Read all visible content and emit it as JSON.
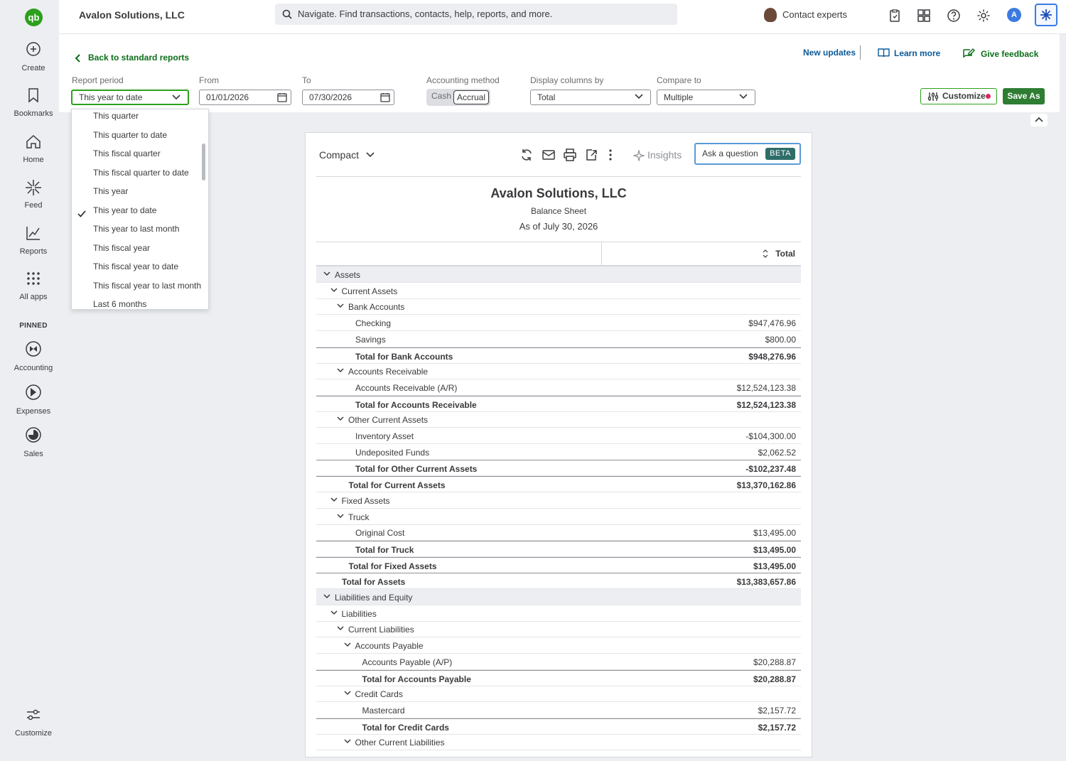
{
  "app": {
    "company_name": "Avalon Solutions, LLC",
    "search_placeholder": "Navigate. Find transactions, contacts, help, reports, and more.",
    "contact_experts": "Contact experts",
    "user_initial": "A",
    "logo_text": "qb"
  },
  "sidebar": {
    "create": "Create",
    "bookmarks": "Bookmarks",
    "home": "Home",
    "feed": "Feed",
    "reports": "Reports",
    "all_apps": "All apps",
    "pinned": "PINNED",
    "accounting": "Accounting",
    "expenses": "Expenses",
    "sales": "Sales",
    "customize": "Customize"
  },
  "header": {
    "back_link": "Back to standard reports",
    "new_updates": "New updates",
    "learn_more": "Learn more",
    "give_feedback": "Give feedback"
  },
  "filters": {
    "report_period_label": "Report period",
    "report_period_value": "This year to date",
    "from_label": "From",
    "from_value": "01/01/2026",
    "to_label": "To",
    "to_value": "07/30/2026",
    "accounting_method_label": "Accounting method",
    "cash": "Cash",
    "accrual": "Accrual",
    "display_columns_label": "Display columns by",
    "display_columns_value": "Total",
    "compare_to_label": "Compare to",
    "compare_to_value": "Multiple",
    "customize": "Customize",
    "save_as": "Save As"
  },
  "period_options": [
    "This quarter",
    "This quarter to date",
    "This fiscal quarter",
    "This fiscal quarter to date",
    "This year",
    "This year to date",
    "This year to last month",
    "This fiscal year",
    "This fiscal year to date",
    "This fiscal year to last month",
    "Last 6 months"
  ],
  "report": {
    "view": "Compact",
    "insights": "Insights",
    "ask": "Ask a question",
    "beta": "BETA",
    "company": "Avalon Solutions, LLC",
    "title": "Balance Sheet",
    "as_of": "As of July 30, 2026",
    "column": "Total",
    "rows": [
      {
        "label": "Assets",
        "value": "",
        "kind": "section",
        "level": 0
      },
      {
        "label": "Current Assets",
        "value": "",
        "kind": "group",
        "level": 1
      },
      {
        "label": "Bank Accounts",
        "value": "",
        "kind": "group",
        "level": 2
      },
      {
        "label": "Checking",
        "value": "$947,476.96",
        "kind": "item",
        "level": 3
      },
      {
        "label": "Savings",
        "value": "$800.00",
        "kind": "item",
        "level": 3
      },
      {
        "label": "Total for Bank Accounts",
        "value": "$948,276.96",
        "kind": "total",
        "level": 3
      },
      {
        "label": "Accounts Receivable",
        "value": "",
        "kind": "group",
        "level": 2
      },
      {
        "label": "Accounts Receivable (A/R)",
        "value": "$12,524,123.38",
        "kind": "item",
        "level": 3
      },
      {
        "label": "Total for Accounts Receivable",
        "value": "$12,524,123.38",
        "kind": "total",
        "level": 3
      },
      {
        "label": "Other Current Assets",
        "value": "",
        "kind": "group",
        "level": 2
      },
      {
        "label": "Inventory Asset",
        "value": "-$104,300.00",
        "kind": "item",
        "level": 3
      },
      {
        "label": "Undeposited Funds",
        "value": "$2,062.52",
        "kind": "item",
        "level": 3
      },
      {
        "label": "Total for Other Current Assets",
        "value": "-$102,237.48",
        "kind": "total",
        "level": 3
      },
      {
        "label": "Total for Current Assets",
        "value": "$13,370,162.86",
        "kind": "total",
        "level": 2
      },
      {
        "label": "Fixed Assets",
        "value": "",
        "kind": "group",
        "level": 1
      },
      {
        "label": "Truck",
        "value": "",
        "kind": "group",
        "level": 2
      },
      {
        "label": "Original Cost",
        "value": "$13,495.00",
        "kind": "item",
        "level": 3
      },
      {
        "label": "Total for Truck",
        "value": "$13,495.00",
        "kind": "total",
        "level": 3
      },
      {
        "label": "Total for Fixed Assets",
        "value": "$13,495.00",
        "kind": "total",
        "level": 2
      },
      {
        "label": "Total for Assets",
        "value": "$13,383,657.86",
        "kind": "total",
        "level": 1
      },
      {
        "label": "Liabilities and Equity",
        "value": "",
        "kind": "section",
        "level": 0
      },
      {
        "label": "Liabilities",
        "value": "",
        "kind": "group",
        "level": 1
      },
      {
        "label": "Current Liabilities",
        "value": "",
        "kind": "group",
        "level": 2
      },
      {
        "label": "Accounts Payable",
        "value": "",
        "kind": "group",
        "level": 3
      },
      {
        "label": "Accounts Payable (A/P)",
        "value": "$20,288.87",
        "kind": "item",
        "level": 4
      },
      {
        "label": "Total for Accounts Payable",
        "value": "$20,288.87",
        "kind": "total",
        "level": 4
      },
      {
        "label": "Credit Cards",
        "value": "",
        "kind": "group",
        "level": 3
      },
      {
        "label": "Mastercard",
        "value": "$2,157.72",
        "kind": "item",
        "level": 4
      },
      {
        "label": "Total for Credit Cards",
        "value": "$2,157.72",
        "kind": "total",
        "level": 4
      },
      {
        "label": "Other Current Liabilities",
        "value": "",
        "kind": "group",
        "level": 3
      }
    ]
  }
}
